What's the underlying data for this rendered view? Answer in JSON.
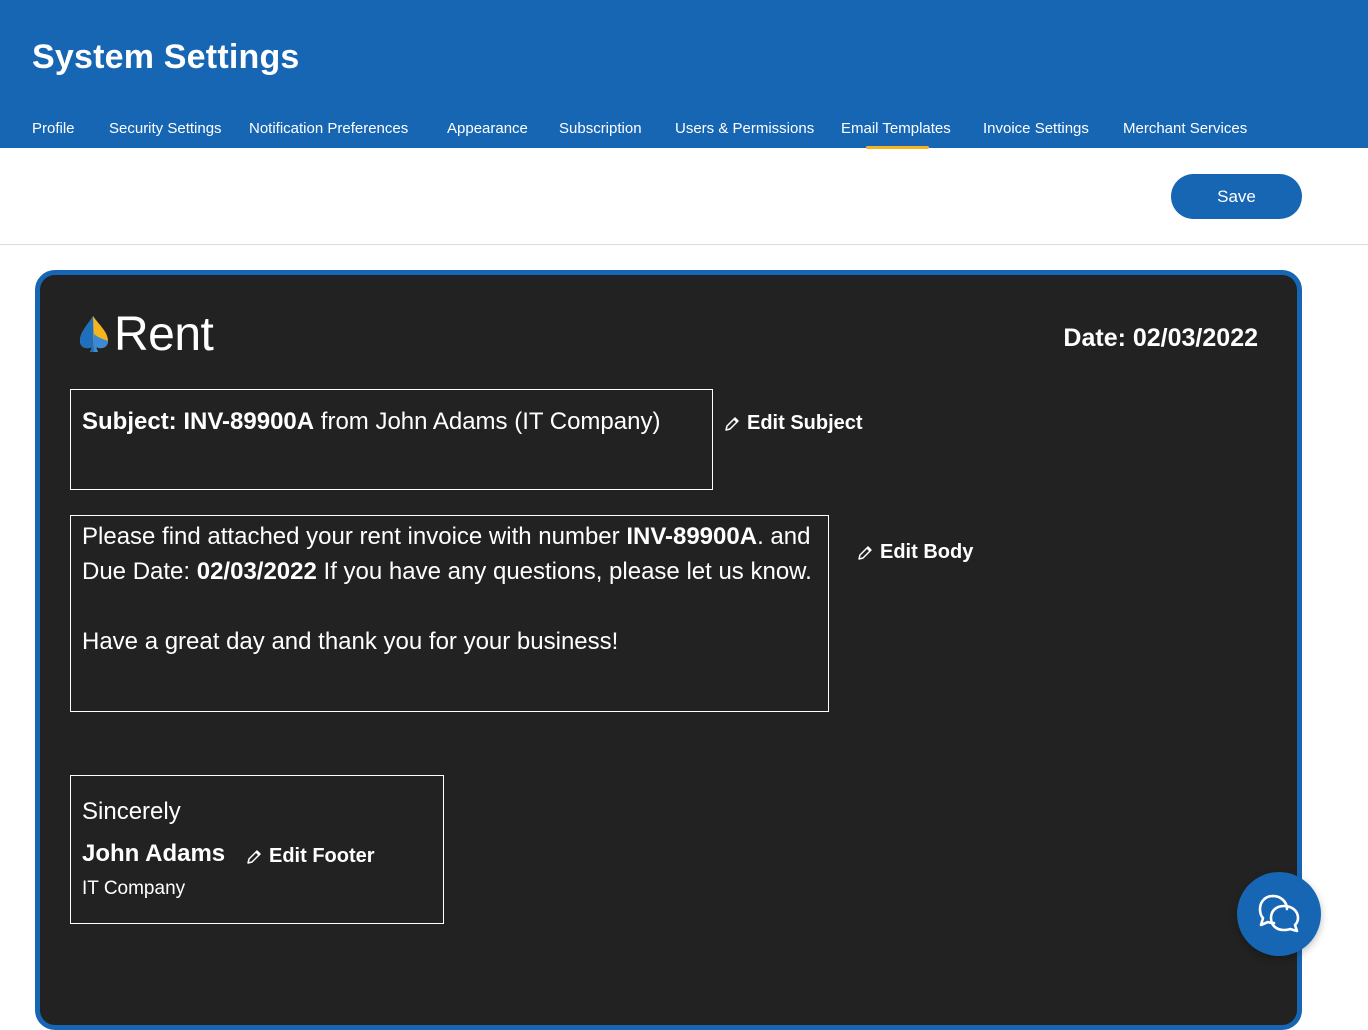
{
  "header": {
    "title": "System Settings",
    "tabs": [
      {
        "label": "Profile"
      },
      {
        "label": "Security Settings"
      },
      {
        "label": "Notification Preferences"
      },
      {
        "label": "Appearance"
      },
      {
        "label": "Subscription"
      },
      {
        "label": "Users & Permissions"
      },
      {
        "label": "Email Templates",
        "active": true
      },
      {
        "label": "Invoice Settings"
      },
      {
        "label": "Merchant Services"
      }
    ]
  },
  "toolbar": {
    "save_label": "Save"
  },
  "template": {
    "brand": "Rent",
    "date_label": "Date:",
    "date_value": "02/03/2022",
    "subject": {
      "label": "Subject:",
      "invoice_number": "INV-89900A",
      "rest": "from John Adams (IT Company)"
    },
    "edit_subject_label": "Edit Subject",
    "body": {
      "text1": "Please find attached your rent invoice with number",
      "invoice_number": "INV-89900A",
      "text2": ". and Due Date:",
      "due_date": "02/03/2022",
      "text3": "If you have any questions, please let us know.",
      "closing": "Have a great day and thank you for your business!"
    },
    "edit_body_label": "Edit Body",
    "footer": {
      "sincerely": "Sincerely",
      "name": "John Adams",
      "company": "IT Company"
    },
    "edit_footer_label": "Edit Footer"
  },
  "colors": {
    "brand_blue": "#1766b4",
    "accent_yellow": "#f4b51e",
    "card_background": "#222222"
  },
  "icons": [
    "pencil-icon",
    "chat-icon",
    "logo-icon"
  ]
}
